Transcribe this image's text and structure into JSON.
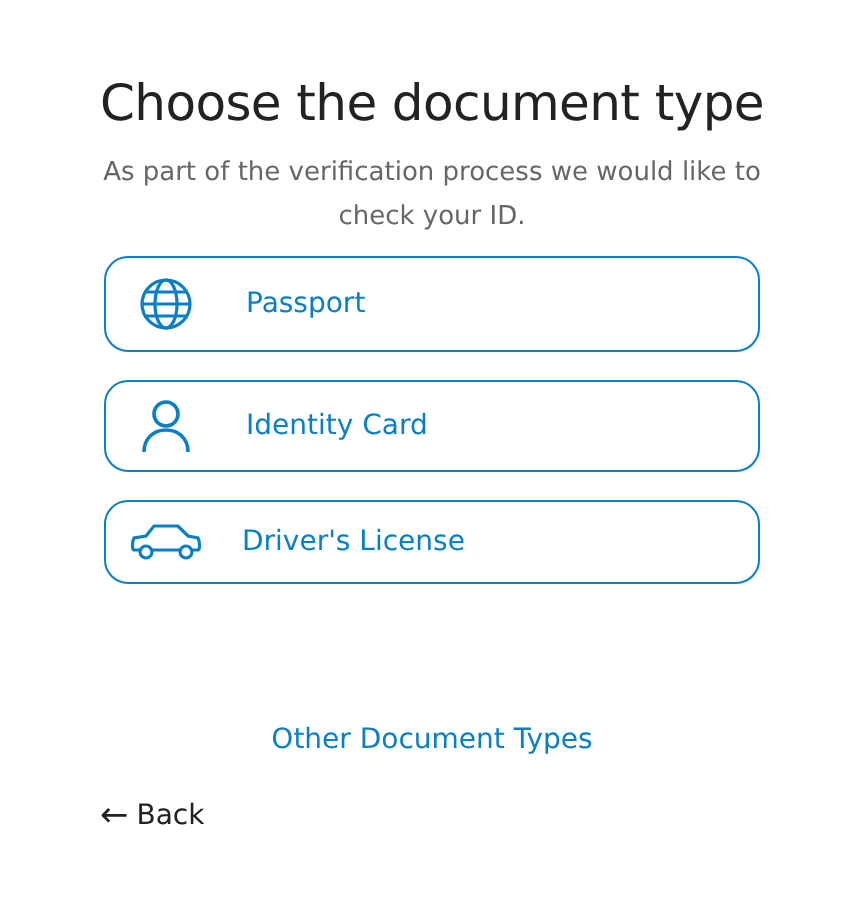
{
  "title": "Choose the document type",
  "subtitle": "As part of the verification process we would like to check your ID.",
  "options": [
    {
      "kind": "globe",
      "label": "Passport"
    },
    {
      "kind": "person",
      "label": "Identity Card"
    },
    {
      "kind": "car",
      "label": "Driver's License"
    }
  ],
  "other_link": "Other Document Types",
  "back": {
    "icon": "←",
    "label": "Back"
  }
}
